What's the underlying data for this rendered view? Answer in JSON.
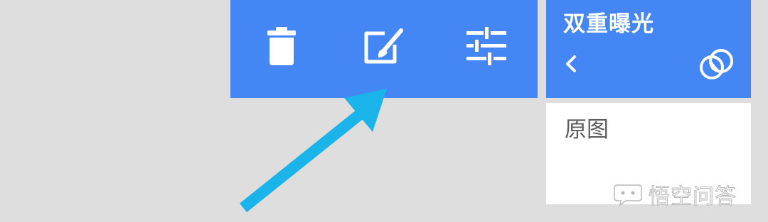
{
  "toolbar": {
    "background": "#4487f4",
    "icons": [
      "trash-icon",
      "edit-brush-icon",
      "sliders-icon"
    ]
  },
  "panel": {
    "title": "双重曝光",
    "back_icon": "chevron-left-icon",
    "blend_icon": "overlap-circles-icon",
    "selected_item": "原图"
  },
  "annotation": {
    "arrow_color": "#1ab4ea"
  },
  "watermark": {
    "text": "悟空问答",
    "icon": "speech-bubble-icon"
  }
}
